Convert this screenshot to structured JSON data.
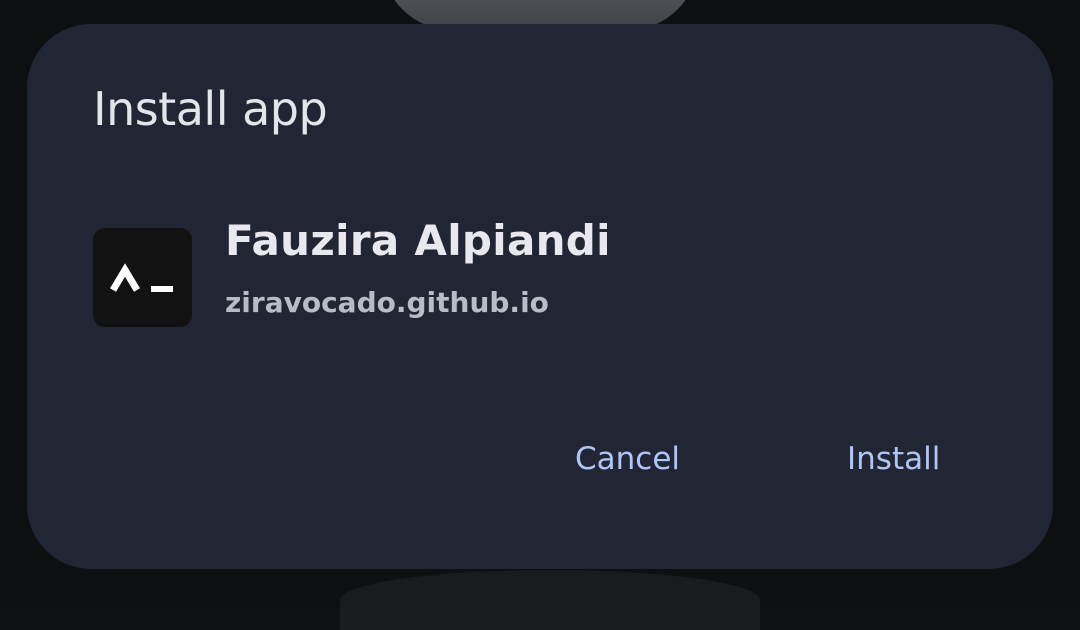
{
  "dialog": {
    "title": "Install app",
    "app_name": "Fauzira Alpiandi",
    "app_url": "ziravocado.github.io",
    "cancel_label": "Cancel",
    "install_label": "Install"
  },
  "icons": {
    "app_icon": "terminal-prompt-icon"
  },
  "colors": {
    "dialog_background": "#222533",
    "button_text": "#aec6f5",
    "title_text": "#e4e5ea"
  }
}
